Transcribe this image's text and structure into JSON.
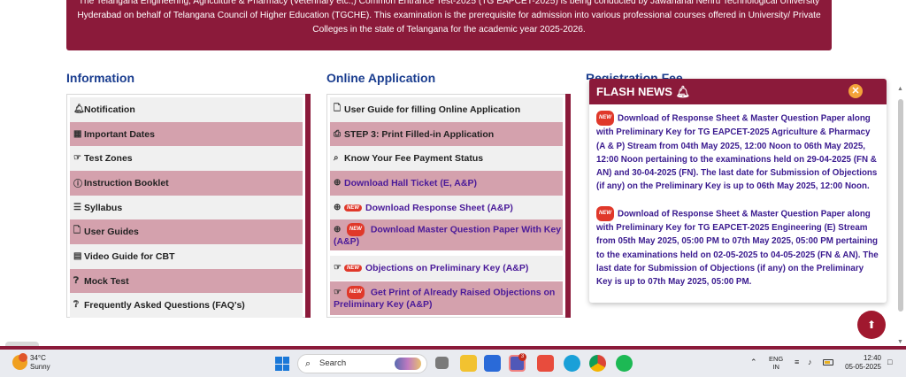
{
  "banner": {
    "line1": "The Telangana Engineering, Agriculture & Pharmacy (Veterinary etc.,) Common Entrance Test-2025 (TG EAPCET-2025) is being conducted by Jawaharlal Nehru Technological University",
    "line2": "Hyderabad on behalf of Telangana Council of Higher Education (TGCHE). This examination is the prerequisite for admission into various professional courses offered in University/ Private",
    "line3": "Colleges in the state of Telangana for the academic year 2025-2026."
  },
  "information": {
    "title": "Information",
    "items": [
      {
        "icon": "bell-icon",
        "label": "Notification"
      },
      {
        "icon": "calendar-icon",
        "label": "Important Dates"
      },
      {
        "icon": "hand-pointer-icon",
        "label": "Test Zones"
      },
      {
        "icon": "info-circle-icon",
        "label": "Instruction Booklet"
      },
      {
        "icon": "list-icon",
        "label": "Syllabus"
      },
      {
        "icon": "file-icon",
        "label": "User Guides"
      },
      {
        "icon": "book-icon",
        "label": "Video Guide for CBT"
      },
      {
        "icon": "question-circle-icon",
        "label": "Mock Test"
      },
      {
        "icon": "question-circle-outline-icon",
        "label": "Frequently Asked Questions (FAQ's)"
      }
    ]
  },
  "online_application": {
    "title": "Online Application",
    "items": [
      {
        "icon": "file-icon",
        "label": "User Guide for filling Online Application"
      },
      {
        "icon": "print-icon",
        "label": "STEP 3: Print Filled-in Application"
      },
      {
        "icon": "search-icon",
        "label": "Know Your Fee Payment Status"
      },
      {
        "icon": "arrow-circle-icon",
        "label": "Download Hall Ticket (E, A&P)"
      },
      {
        "icon": "arrow-circle-icon",
        "label": "Download Response Sheet (A&P)",
        "badge": "NEW"
      },
      {
        "icon": "arrow-circle-icon",
        "label": "Download Master Question Paper With Key (A&P)",
        "badge": "NEW"
      },
      {
        "icon": "hand-pointer-icon",
        "label": "Objections on Preliminary Key (A&P)",
        "badge": "NEW"
      },
      {
        "icon": "hand-pointer-icon",
        "label": "Get Print of Already Raised Objections on Preliminary Key (A&P)",
        "badge": "NEW"
      }
    ]
  },
  "registration_fee": {
    "title": "Registration Fee"
  },
  "flash_news": {
    "title": "FLASH NEWS",
    "badge": "NEW",
    "items": [
      "Download of Response Sheet & Master Question Paper along with Preliminary Key for TG EAPCET-2025 Agriculture & Pharmacy (A & P) Stream from 04th May 2025, 12:00 Noon to 06th May 2025, 12:00 Noon pertaining to the examinations held on 29-04-2025 (FN & AN) and 30-04-2025 (FN). The last date for Submission of Objections (if any) on the Preliminary Key is up to 06th May 2025, 12:00 Noon.",
      "Download of Response Sheet & Master Question Paper along with Preliminary Key for TG EAPCET-2025 Engineering (E) Stream from 05th May 2025, 05:00 PM to 07th May 2025, 05:00 PM pertaining to the examinations held on 02-05-2025 to 04-05-2025 (FN & AN). The last date for Submission of Objections (if any) on the Preliminary Key is up to 07th May 2025, 05:00 PM."
    ]
  },
  "taskbar": {
    "temperature": "34°C",
    "weather": "Sunny",
    "search_placeholder": "Search",
    "teams_badge": "3",
    "lang1": "ENG",
    "lang2": "IN",
    "time": "12:40",
    "date": "05-05-2025"
  }
}
